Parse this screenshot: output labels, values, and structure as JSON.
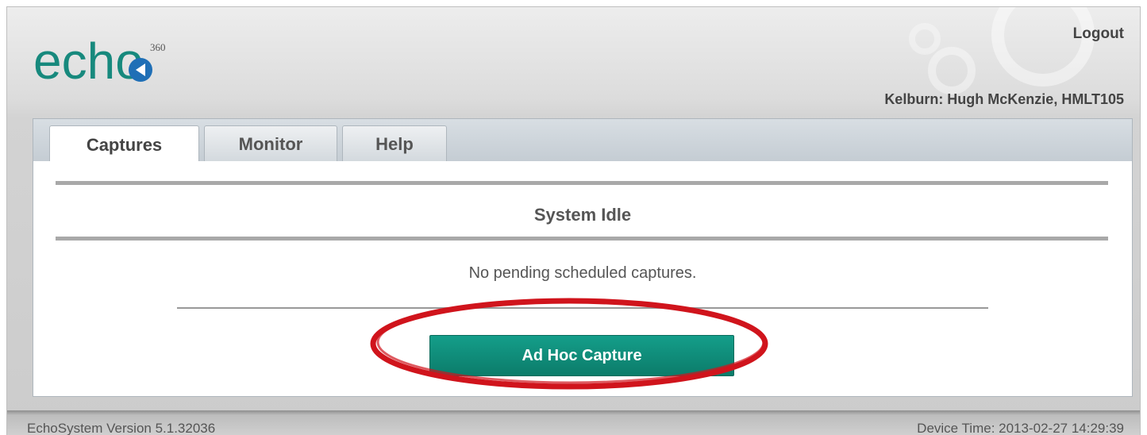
{
  "header": {
    "logo_text": "echo",
    "logo_superscript": "360",
    "logout_label": "Logout",
    "location": "Kelburn: Hugh McKenzie, HMLT105"
  },
  "tabs": [
    {
      "label": "Captures",
      "active": true
    },
    {
      "label": "Monitor",
      "active": false
    },
    {
      "label": "Help",
      "active": false
    }
  ],
  "main": {
    "status_title": "System Idle",
    "pending_message": "No pending scheduled captures.",
    "adhoc_button_label": "Ad Hoc Capture"
  },
  "footer": {
    "version": "EchoSystem Version 5.1.32036",
    "device_time": "Device Time: 2013-02-27 14:29:39"
  },
  "colors": {
    "brand_teal": "#17897d",
    "button_teal": "#0f8d7a",
    "annotation_red": "#d0141c"
  }
}
